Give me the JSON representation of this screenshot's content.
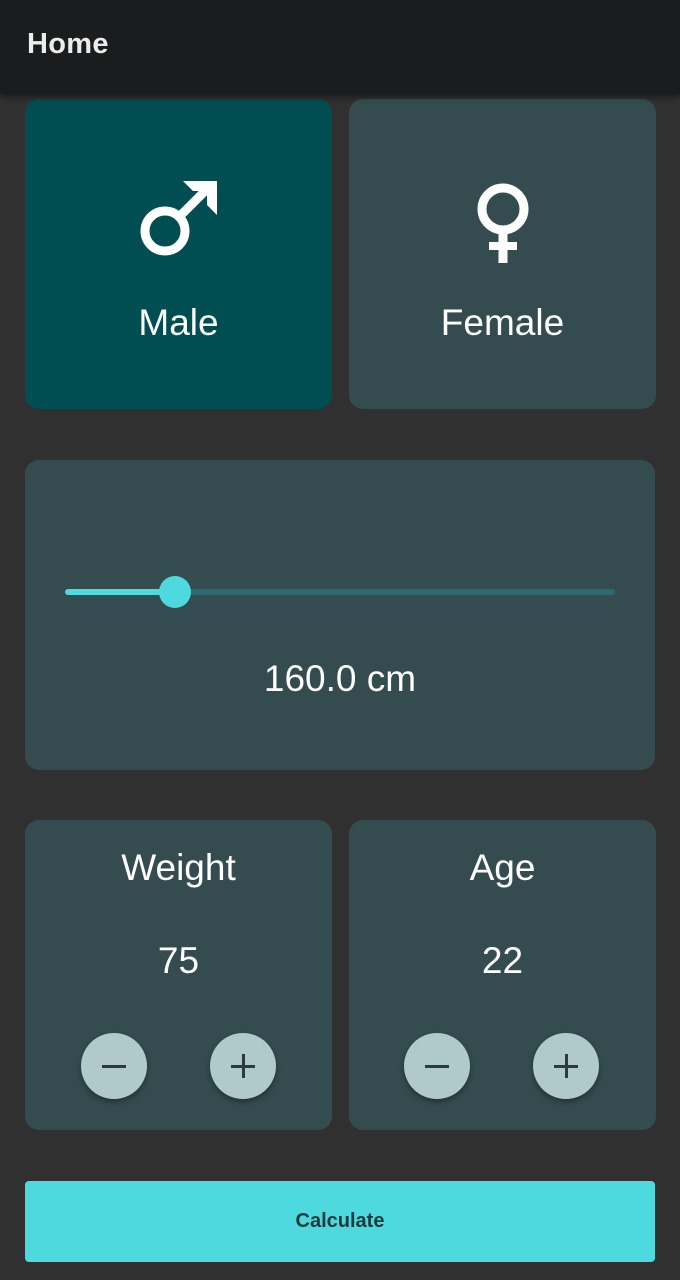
{
  "appbar": {
    "title": "Home"
  },
  "gender": {
    "male": {
      "label": "Male",
      "icon": "male-icon",
      "selected": true
    },
    "female": {
      "label": "Female",
      "icon": "female-icon",
      "selected": false
    }
  },
  "height": {
    "value_text": "160.0 cm",
    "slider_fraction": 0.2
  },
  "weight": {
    "title": "Weight",
    "value": "75",
    "decrement_icon": "minus-icon",
    "increment_icon": "plus-icon"
  },
  "age": {
    "title": "Age",
    "value": "22",
    "decrement_icon": "minus-icon",
    "increment_icon": "plus-icon"
  },
  "calculate": {
    "label": "Calculate"
  },
  "colors": {
    "background": "#303030",
    "card": "#344c4f",
    "card_selected": "#004d52",
    "accent": "#4dd9dd",
    "appbar": "#1a1c1d"
  }
}
